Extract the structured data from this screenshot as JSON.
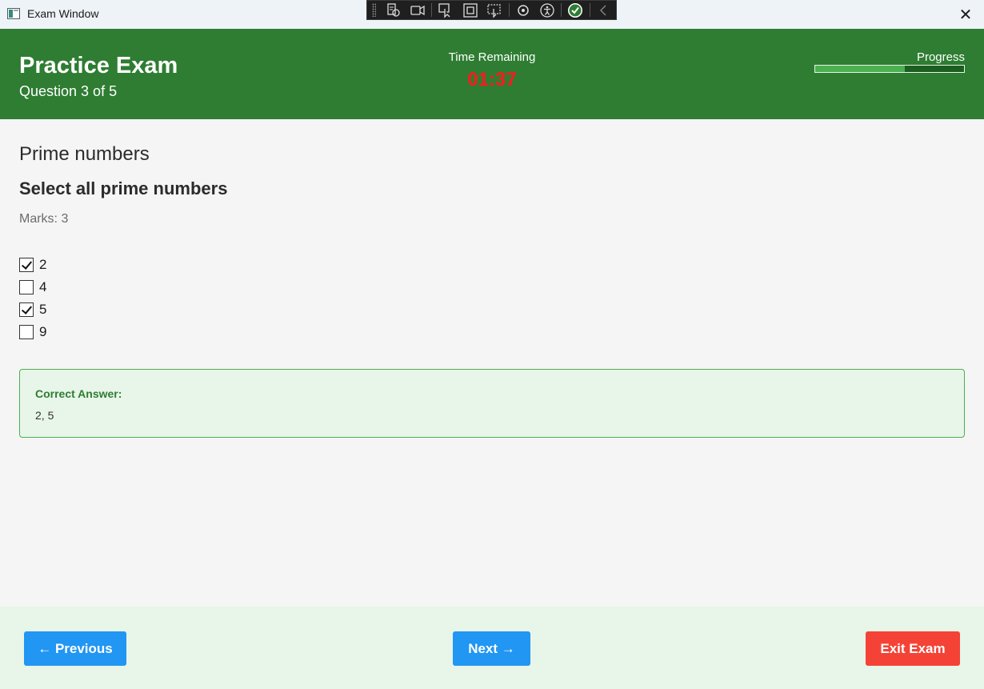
{
  "window": {
    "title": "Exam Window",
    "close_glyph": "✕"
  },
  "devtools": {
    "icons": [
      "select-element-icon",
      "record-icon",
      "pointer-icon",
      "box-icon",
      "frame-select-icon",
      "hot-reload-icon",
      "accessibility-icon",
      "check-icon",
      "collapse-icon"
    ]
  },
  "header": {
    "title": "Practice Exam",
    "question_count": "Question 3 of 5",
    "timer_label": "Time Remaining",
    "timer_value": "01:37",
    "progress_label": "Progress",
    "progress_fraction": 0.6
  },
  "question": {
    "title": "Prime numbers",
    "text": "Select all prime numbers",
    "marks": "Marks: 3",
    "options": [
      {
        "label": "2",
        "checked": true
      },
      {
        "label": "4",
        "checked": false
      },
      {
        "label": "5",
        "checked": true
      },
      {
        "label": "9",
        "checked": false
      }
    ]
  },
  "answer": {
    "title": "Correct Answer:",
    "value": "2, 5"
  },
  "footer": {
    "previous_label": "← Previous",
    "next_label": "Next →",
    "exit_label": "Exit Exam"
  },
  "colors": {
    "header_bg": "#2e7d32",
    "timer": "#ff1a1a",
    "button_blue": "#2196f3",
    "button_red": "#f44336",
    "answer_bg": "#e8f5e9"
  }
}
